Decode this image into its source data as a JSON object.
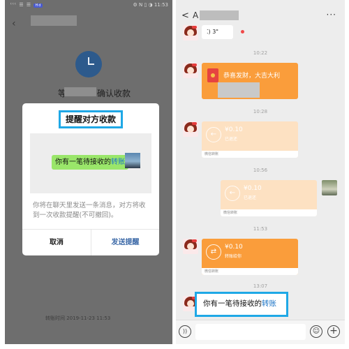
{
  "left": {
    "statusbar": {
      "left": "ᵗᵗᵗ ☰ ☰",
      "badge": "Hd",
      "right": "⚙ N ▯ ◑ 11:53"
    },
    "header": {
      "back_icon": "chevron-left-icon"
    },
    "status": {
      "prefix": "等",
      "suffix": "确认收款"
    },
    "dialog": {
      "title": "提醒对方收款",
      "preview_message_prefix": "你有一笔待接收的",
      "preview_message_link": "转账",
      "description": "你将在聊天里发送一条消息，对方将收到一次收款提醒(不可撤回)。",
      "cancel": "取消",
      "confirm": "发送提醒"
    },
    "transfer_time": "转账时间 2019-11-23 11:53"
  },
  "right": {
    "header": {
      "back": "<",
      "name_initial": "A",
      "more": "···"
    },
    "voice_message": {
      "label": "3\""
    },
    "times": [
      "10:22",
      "10:28",
      "10:56",
      "11:53",
      "13:07"
    ],
    "red_packet": {
      "title": "恭喜发财，大吉大利"
    },
    "transfers": [
      {
        "amount": "¥0.10",
        "status": "已退还",
        "footer": "微信转账"
      },
      {
        "amount": "¥0.10",
        "status": "已退还",
        "footer": "微信转账"
      },
      {
        "amount": "¥0.10",
        "status": "转账给你",
        "footer": "微信转账"
      }
    ],
    "reminder_message": {
      "prefix": "你有一笔待接收的",
      "link": "转账"
    },
    "input_bar": {
      "voice_icon": "voice-icon",
      "emoji_icon": "emoji-icon",
      "plus_icon": "plus-icon"
    }
  },
  "colors": {
    "accent_frame": "#1fa8e6",
    "transfer_orange": "#fa9d3b",
    "transfer_faded": "#fde1c2",
    "bubble_green": "#9ae66a",
    "link_blue": "#1a73c6"
  }
}
